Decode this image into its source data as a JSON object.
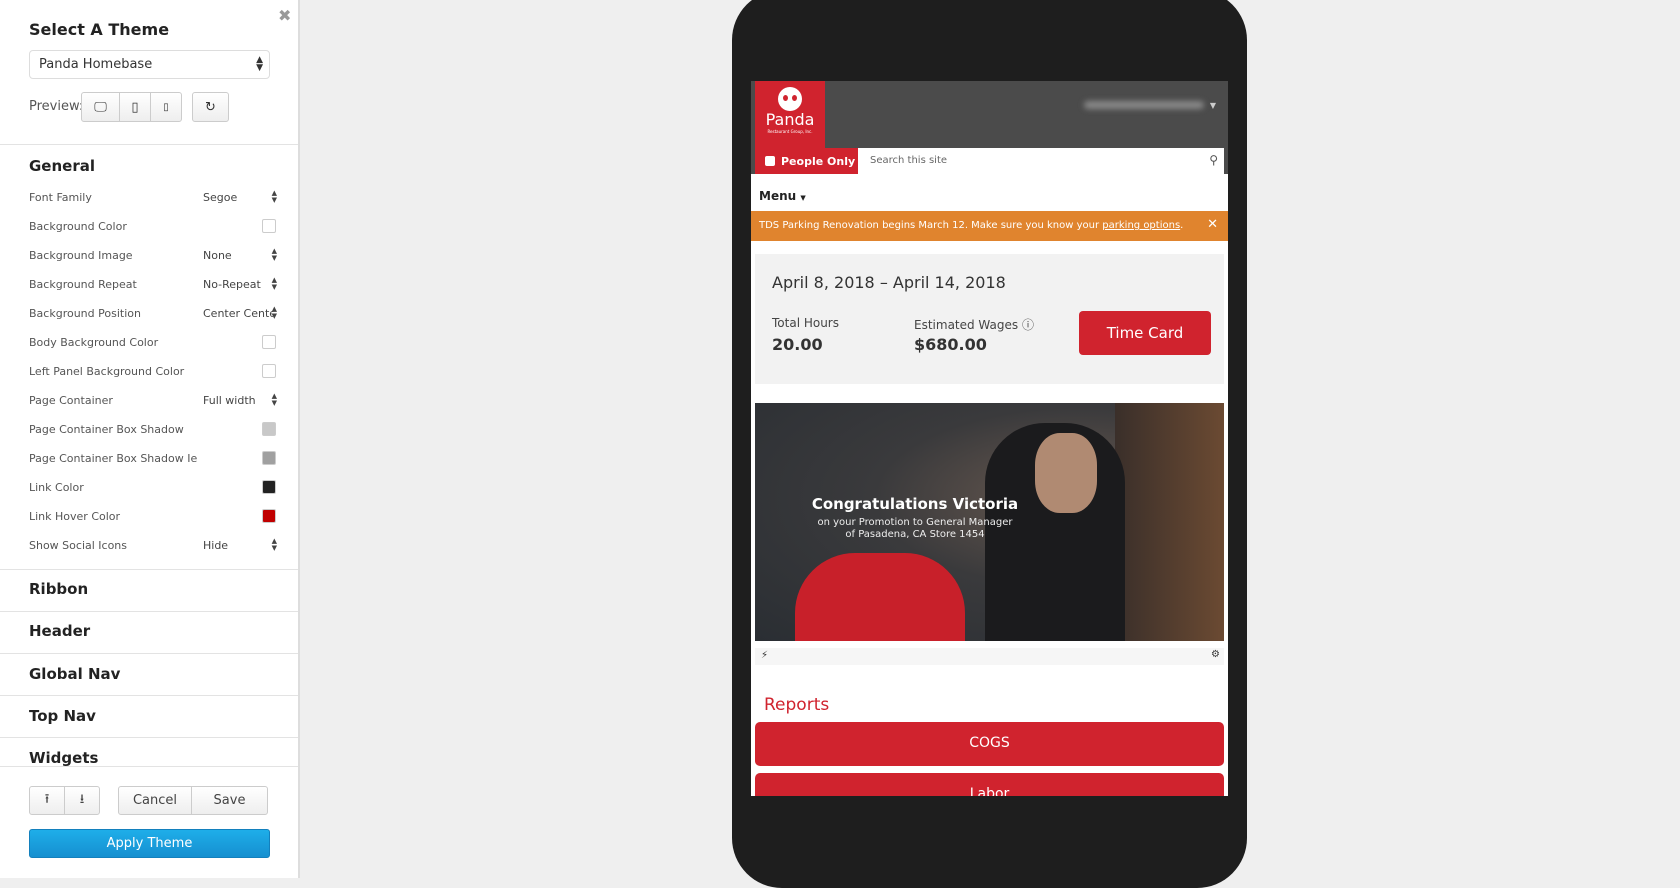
{
  "panel": {
    "title": "Select A Theme",
    "theme": "Panda Homebase",
    "preview_label": "Preview:",
    "general": "General",
    "rows": [
      {
        "label": "Font Family",
        "value": "Segoe"
      },
      {
        "label": "Background Color",
        "color": "#ffffff"
      },
      {
        "label": "Background Image",
        "value": "None"
      },
      {
        "label": "Background Repeat",
        "value": "No-Repeat"
      },
      {
        "label": "Background Position",
        "value": "Center Center"
      },
      {
        "label": "Body Background Color",
        "color": "#ffffff"
      },
      {
        "label": "Left Panel Background Color",
        "color": "#ffffff"
      },
      {
        "label": "Page Container",
        "value": "Full width"
      },
      {
        "label": "Page Container Box Shadow",
        "color": "#c8c8c8"
      },
      {
        "label": "Page Container Box Shadow Ie",
        "color": "#a0a0a0"
      },
      {
        "label": "Link Color",
        "color": "#222222"
      },
      {
        "label": "Link Hover Color",
        "color": "#c00000"
      },
      {
        "label": "Show Social Icons",
        "value": "Hide"
      }
    ],
    "sections": [
      "Ribbon",
      "Header",
      "Global Nav",
      "Top Nav",
      "Widgets"
    ],
    "cancel": "Cancel",
    "save": "Save",
    "apply": "Apply Theme"
  },
  "site": {
    "logo": "Panda",
    "logo_sub": "Restaurant Group, Inc.",
    "people_only": "People Only",
    "search_placeholder": "Search this site",
    "menu": "Menu",
    "banner_text": "TDS Parking Renovation begins March 12. Make sure you know your ",
    "banner_link": "parking options",
    "banner_end": ".",
    "date_range": "April 8, 2018 – April 14, 2018",
    "total_hours_label": "Total Hours",
    "total_hours": "20.00",
    "wages_label": "Estimated Wages",
    "wages": "$680.00",
    "time_card": "Time Card",
    "hero_title": "Congratulations Victoria",
    "hero_sub1": "on your Promotion to General Manager",
    "hero_sub2": "of Pasadena, CA Store 1454",
    "reports": "Reports",
    "report_buttons": [
      "COGS",
      "Labor"
    ]
  },
  "colors": {
    "brand_red": "#d0232e",
    "banner_orange": "#e0842e",
    "apply_blue": "#1a9fdf"
  }
}
